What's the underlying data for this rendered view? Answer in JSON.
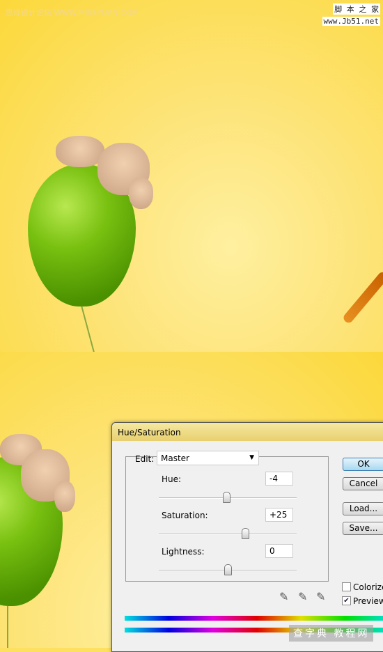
{
  "watermarks": {
    "top_left": "思缘设计论坛 WWW.MISSYUAN.COM",
    "top_right_line1": "脚 本 之 家",
    "top_right_line2": "www.Jb51.net",
    "bottom": "查字典 教程网"
  },
  "dialog": {
    "title": "Hue/Saturation",
    "edit_label": "Edit:",
    "edit_value": "Master",
    "hue": {
      "label": "Hue:",
      "value": "-4",
      "min": -180,
      "max": 180
    },
    "saturation": {
      "label": "Saturation:",
      "value": "+25",
      "min": -100,
      "max": 100
    },
    "lightness": {
      "label": "Lightness:",
      "value": "0",
      "min": -100,
      "max": 100
    },
    "buttons": {
      "ok": "OK",
      "cancel": "Cancel",
      "load": "Load...",
      "save": "Save..."
    },
    "colorize": {
      "label": "Colorize",
      "checked": false
    },
    "preview": {
      "label": "Preview",
      "checked": true
    },
    "tools": [
      "eyedropper-icon",
      "eyedropper-plus-icon",
      "eyedropper-minus-icon"
    ]
  }
}
